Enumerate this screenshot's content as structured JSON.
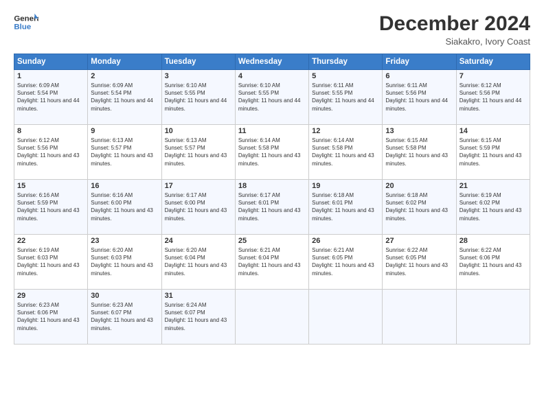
{
  "header": {
    "logo_line1": "General",
    "logo_line2": "Blue",
    "month_title": "December 2024",
    "location": "Siakakro, Ivory Coast"
  },
  "weekdays": [
    "Sunday",
    "Monday",
    "Tuesday",
    "Wednesday",
    "Thursday",
    "Friday",
    "Saturday"
  ],
  "weeks": [
    [
      {
        "day": 1,
        "sunrise": "6:09 AM",
        "sunset": "5:54 PM",
        "daylight": "11 hours and 44 minutes."
      },
      {
        "day": 2,
        "sunrise": "6:09 AM",
        "sunset": "5:54 PM",
        "daylight": "11 hours and 44 minutes."
      },
      {
        "day": 3,
        "sunrise": "6:10 AM",
        "sunset": "5:55 PM",
        "daylight": "11 hours and 44 minutes."
      },
      {
        "day": 4,
        "sunrise": "6:10 AM",
        "sunset": "5:55 PM",
        "daylight": "11 hours and 44 minutes."
      },
      {
        "day": 5,
        "sunrise": "6:11 AM",
        "sunset": "5:55 PM",
        "daylight": "11 hours and 44 minutes."
      },
      {
        "day": 6,
        "sunrise": "6:11 AM",
        "sunset": "5:56 PM",
        "daylight": "11 hours and 44 minutes."
      },
      {
        "day": 7,
        "sunrise": "6:12 AM",
        "sunset": "5:56 PM",
        "daylight": "11 hours and 44 minutes."
      }
    ],
    [
      {
        "day": 8,
        "sunrise": "6:12 AM",
        "sunset": "5:56 PM",
        "daylight": "11 hours and 43 minutes."
      },
      {
        "day": 9,
        "sunrise": "6:13 AM",
        "sunset": "5:57 PM",
        "daylight": "11 hours and 43 minutes."
      },
      {
        "day": 10,
        "sunrise": "6:13 AM",
        "sunset": "5:57 PM",
        "daylight": "11 hours and 43 minutes."
      },
      {
        "day": 11,
        "sunrise": "6:14 AM",
        "sunset": "5:58 PM",
        "daylight": "11 hours and 43 minutes."
      },
      {
        "day": 12,
        "sunrise": "6:14 AM",
        "sunset": "5:58 PM",
        "daylight": "11 hours and 43 minutes."
      },
      {
        "day": 13,
        "sunrise": "6:15 AM",
        "sunset": "5:58 PM",
        "daylight": "11 hours and 43 minutes."
      },
      {
        "day": 14,
        "sunrise": "6:15 AM",
        "sunset": "5:59 PM",
        "daylight": "11 hours and 43 minutes."
      }
    ],
    [
      {
        "day": 15,
        "sunrise": "6:16 AM",
        "sunset": "5:59 PM",
        "daylight": "11 hours and 43 minutes."
      },
      {
        "day": 16,
        "sunrise": "6:16 AM",
        "sunset": "6:00 PM",
        "daylight": "11 hours and 43 minutes."
      },
      {
        "day": 17,
        "sunrise": "6:17 AM",
        "sunset": "6:00 PM",
        "daylight": "11 hours and 43 minutes."
      },
      {
        "day": 18,
        "sunrise": "6:17 AM",
        "sunset": "6:01 PM",
        "daylight": "11 hours and 43 minutes."
      },
      {
        "day": 19,
        "sunrise": "6:18 AM",
        "sunset": "6:01 PM",
        "daylight": "11 hours and 43 minutes."
      },
      {
        "day": 20,
        "sunrise": "6:18 AM",
        "sunset": "6:02 PM",
        "daylight": "11 hours and 43 minutes."
      },
      {
        "day": 21,
        "sunrise": "6:19 AM",
        "sunset": "6:02 PM",
        "daylight": "11 hours and 43 minutes."
      }
    ],
    [
      {
        "day": 22,
        "sunrise": "6:19 AM",
        "sunset": "6:03 PM",
        "daylight": "11 hours and 43 minutes."
      },
      {
        "day": 23,
        "sunrise": "6:20 AM",
        "sunset": "6:03 PM",
        "daylight": "11 hours and 43 minutes."
      },
      {
        "day": 24,
        "sunrise": "6:20 AM",
        "sunset": "6:04 PM",
        "daylight": "11 hours and 43 minutes."
      },
      {
        "day": 25,
        "sunrise": "6:21 AM",
        "sunset": "6:04 PM",
        "daylight": "11 hours and 43 minutes."
      },
      {
        "day": 26,
        "sunrise": "6:21 AM",
        "sunset": "6:05 PM",
        "daylight": "11 hours and 43 minutes."
      },
      {
        "day": 27,
        "sunrise": "6:22 AM",
        "sunset": "6:05 PM",
        "daylight": "11 hours and 43 minutes."
      },
      {
        "day": 28,
        "sunrise": "6:22 AM",
        "sunset": "6:06 PM",
        "daylight": "11 hours and 43 minutes."
      }
    ],
    [
      {
        "day": 29,
        "sunrise": "6:23 AM",
        "sunset": "6:06 PM",
        "daylight": "11 hours and 43 minutes."
      },
      {
        "day": 30,
        "sunrise": "6:23 AM",
        "sunset": "6:07 PM",
        "daylight": "11 hours and 43 minutes."
      },
      {
        "day": 31,
        "sunrise": "6:24 AM",
        "sunset": "6:07 PM",
        "daylight": "11 hours and 43 minutes."
      },
      null,
      null,
      null,
      null
    ]
  ]
}
